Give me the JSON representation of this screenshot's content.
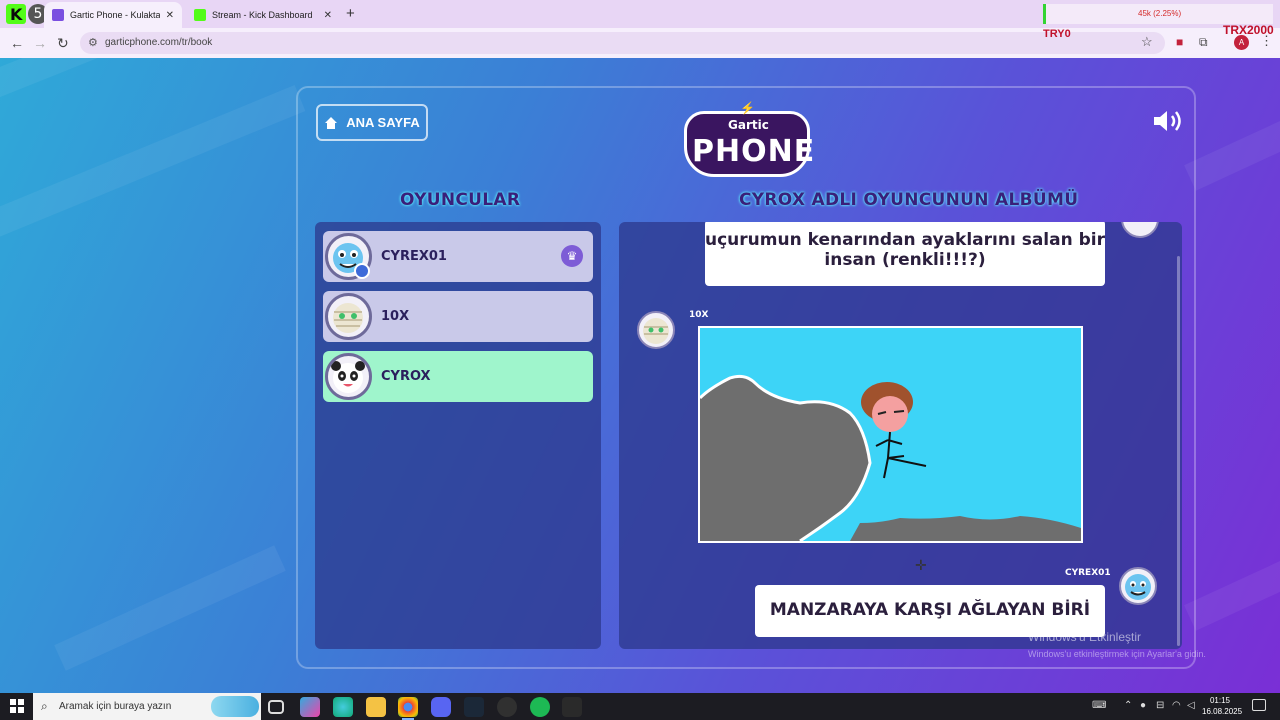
{
  "browser": {
    "tab_count": "5",
    "tabs": [
      {
        "title": "Gartic Phone - Kulaktan Kulağa",
        "active": true
      },
      {
        "title": "Stream - Kick Dashboard",
        "active": false
      }
    ],
    "url": "garticphone.com/tr/book",
    "stream_stat": "45k (2.25%)",
    "overlay_left": "TRY0",
    "overlay_right": "TRX2000",
    "profile_initial": "A"
  },
  "header": {
    "home_label": "ANA SAYFA",
    "logo_top": "Gartic",
    "logo_bottom": "PHONE"
  },
  "sections": {
    "players_title": "OYUNCULAR",
    "album_title": "CYROX ADLI OYUNCUNUN ALBÜMÜ"
  },
  "players": [
    {
      "name": "CYREX01",
      "host": true,
      "selected": false
    },
    {
      "name": "10X",
      "host": false,
      "selected": false
    },
    {
      "name": "CYROX",
      "host": false,
      "selected": true
    }
  ],
  "album": {
    "first_prompt": "uçurumun kenarından ayaklarını salan bir insan (renkli!!!?)",
    "drawing_author": "10X",
    "final_author": "CYREX01",
    "final_guess": "MANZARAYA KARŞI AĞLAYAN BİRİ"
  },
  "windows": {
    "activate_title": "Windows'u Etkinleştir",
    "activate_sub": "Windows'u etkinleştirmek için Ayarlar'a gidin."
  },
  "taskbar": {
    "search_placeholder": "Aramak için buraya yazın",
    "time": "01:15",
    "date": "16.08.2025"
  },
  "colors": {
    "selected_row": "#9ff5cc",
    "row": "#c9c9e9",
    "title_text": "#3a1f7a",
    "sky": "#3dd4f7",
    "rock": "#6e6e6e"
  }
}
